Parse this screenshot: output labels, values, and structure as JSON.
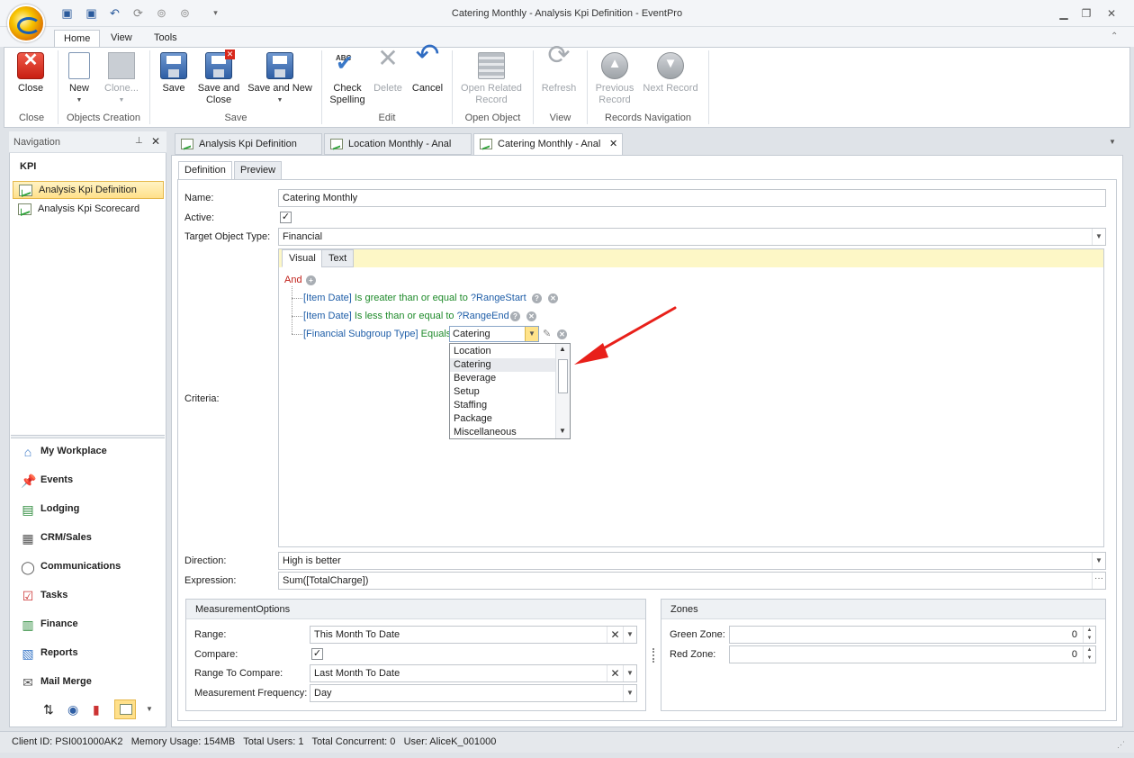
{
  "window": {
    "title": "Catering Monthly - Analysis Kpi Definition - EventPro"
  },
  "ribbon_tabs": [
    "Home",
    "View",
    "Tools"
  ],
  "ribbon": {
    "close": "Close",
    "new": "New",
    "clone": "Clone...",
    "save": "Save",
    "save_close": "Save and Close",
    "save_new": "Save and New",
    "check_spelling": "Check Spelling",
    "delete": "Delete",
    "cancel": "Cancel",
    "open_related": "Open Related Record",
    "refresh": "Refresh",
    "previous": "Previous Record",
    "next": "Next Record",
    "groups": {
      "close": "Close",
      "objects": "Objects Creation",
      "save": "Save",
      "edit": "Edit",
      "open": "Open Object",
      "view": "View",
      "nav": "Records Navigation"
    }
  },
  "navigation": {
    "header": "Navigation",
    "section": "KPI",
    "items": [
      "Analysis Kpi Definition",
      "Analysis Kpi Scorecard"
    ],
    "modules": [
      "My Workplace",
      "Events",
      "Lodging",
      "CRM/Sales",
      "Communications",
      "Tasks",
      "Finance",
      "Reports",
      "Mail Merge"
    ]
  },
  "doc_tabs": [
    "Analysis Kpi Definition",
    "Location Monthly - Anal",
    "Catering Monthly - Anal"
  ],
  "inner_tabs": [
    "Definition",
    "Preview"
  ],
  "form": {
    "name_label": "Name:",
    "name_value": "Catering Monthly",
    "active_label": "Active:",
    "target_label": "Target Object Type:",
    "target_value": "Financial",
    "criteria_label": "Criteria:",
    "direction_label": "Direction:",
    "direction_value": "High is better",
    "expression_label": "Expression:",
    "expression_value": "Sum([TotalCharge])"
  },
  "criteria": {
    "tabs": [
      "Visual",
      "Text"
    ],
    "root": "And",
    "conditions": [
      {
        "field": "[Item Date]",
        "op": "Is greater than or equal to",
        "value": "?RangeStart"
      },
      {
        "field": "[Item Date]",
        "op": "Is less than or equal to",
        "value": "?RangeEnd"
      },
      {
        "field": "[Financial Subgroup Type]",
        "op": "Equals",
        "value": "Catering"
      }
    ],
    "dropdown_options": [
      "Location",
      "Catering",
      "Beverage",
      "Setup",
      "Staffing",
      "Package",
      "Miscellaneous"
    ]
  },
  "measurement": {
    "title": "MeasurementOptions",
    "range_label": "Range:",
    "range_value": "This Month To Date",
    "compare_label": "Compare:",
    "range_compare_label": "Range To Compare:",
    "range_compare_value": "Last Month To Date",
    "freq_label": "Measurement Frequency:",
    "freq_value": "Day"
  },
  "zones": {
    "title": "Zones",
    "green_label": "Green Zone:",
    "green_value": "0",
    "red_label": "Red Zone:",
    "red_value": "0"
  },
  "status": {
    "client": "Client ID: PSI001000AK2",
    "memory": "Memory Usage: 154MB",
    "users": "Total Users: 1",
    "concurrent": "Total Concurrent: 0",
    "user": "User: AliceK_001000"
  }
}
